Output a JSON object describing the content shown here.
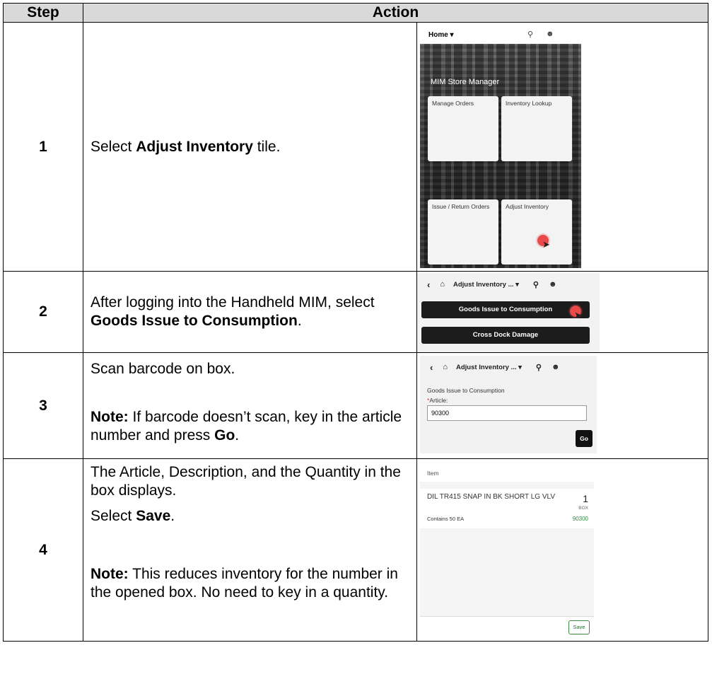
{
  "table": {
    "header_step": "Step",
    "header_action": "Action"
  },
  "steps": [
    {
      "number": "1",
      "text_before": "Select ",
      "text_bold": "Adjust Inventory",
      "text_after": " tile.",
      "screenshot": {
        "home_label": "Home ▾",
        "search_icon": "search-icon",
        "user_icon": "user-icon",
        "brand": "MIM Store Manager",
        "tiles": [
          "Manage Orders",
          "Inventory Lookup",
          "Issue / Return Orders",
          "Adjust Inventory"
        ]
      }
    },
    {
      "number": "2",
      "text_before": "After logging into the Handheld MIM, select ",
      "text_bold": "Goods Issue to Consumption",
      "text_after": ".",
      "screenshot": {
        "title": "Adjust Inventory ...  ▾",
        "buttons": [
          "Goods Issue to Consumption",
          "Cross Dock Damage"
        ]
      }
    },
    {
      "number": "3",
      "text_line1": "Scan barcode on box.",
      "note_label": "Note:",
      "note_text": "  If barcode doesn’t scan, key in the article number and press ",
      "note_bold": "Go",
      "note_after": ".",
      "screenshot": {
        "title": "Adjust Inventory ...  ▾",
        "section": "Goods Issue to Consumption",
        "required_mark": "*",
        "field_label": "Article:",
        "field_value": "90300",
        "go_label": "Go"
      }
    },
    {
      "number": "4",
      "text_line1": "The Article, Description, and the Quantity in the box displays.",
      "select_before": "Select ",
      "select_bold": "Save",
      "select_after": ".",
      "note_label": "Note:",
      "note_text": " This reduces inventory for the number in the opened box. No need to key in a quantity.",
      "screenshot": {
        "header": "Item",
        "description": "DIL TR415 SNAP IN BK SHORT LG VLV",
        "quantity": "1",
        "uom": "BOX",
        "contains": "Contains 50 EA",
        "article": "90300",
        "save_label": "Save"
      }
    }
  ]
}
